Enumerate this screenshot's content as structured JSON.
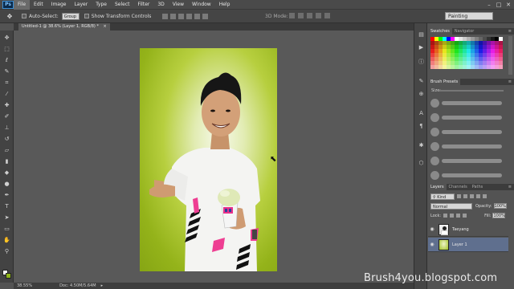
{
  "app": {
    "logo": "Ps"
  },
  "menu": [
    "File",
    "Edit",
    "Image",
    "Layer",
    "Type",
    "Select",
    "Filter",
    "3D",
    "View",
    "Window",
    "Help"
  ],
  "options": {
    "auto_select_label": "Auto-Select:",
    "auto_select_value": "Group",
    "transform_label": "Show Transform Controls",
    "mode_3d_label": "3D Mode:",
    "workspace": "Painting"
  },
  "document": {
    "tab_title": "Untitled-1 @ 38.6% (Layer 1, RGB/8) *",
    "tab_close": "×"
  },
  "status": {
    "zoom": "38.55%",
    "doc": "Doc: 4.50M/5.64M"
  },
  "panels": {
    "swatches_tab": "Swatches",
    "navigator_tab": "Navigator",
    "brush_presets_tab": "Brush Presets",
    "brush_size_label": "Size:",
    "layers_tab": "Layers",
    "channels_tab": "Channels",
    "paths_tab": "Paths",
    "kind_label": "Kind",
    "blend_mode": "Normal",
    "opacity_label": "Opacity:",
    "opacity_value": "100%",
    "lock_label": "Lock:",
    "fill_label": "Fill:",
    "fill_value": "100%"
  },
  "layers": [
    {
      "name": "Taeyang",
      "selected": false
    },
    {
      "name": "Layer 1",
      "selected": true
    }
  ],
  "colors": {
    "background_swatch": "#8fb51a",
    "selection": "#5f6f8e"
  },
  "watermark": "Brush4you.blogspot.com"
}
